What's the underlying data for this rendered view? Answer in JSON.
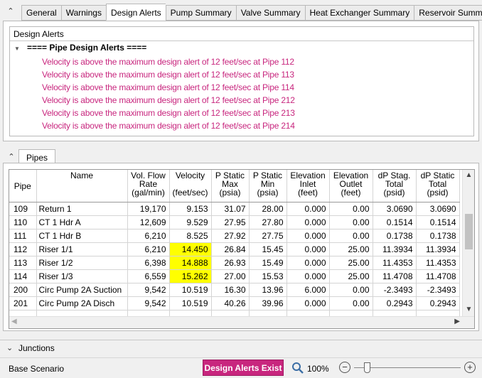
{
  "tabs": [
    "General",
    "Warnings",
    "Design Alerts",
    "Pump Summary",
    "Valve Summary",
    "Heat Exchanger Summary",
    "Reservoir Summary"
  ],
  "active_tab": "Design Alerts",
  "alerts_panel": {
    "title": "Design Alerts",
    "group_header": "==== Pipe Design Alerts ====",
    "items": [
      "Velocity is above the maximum design alert of 12 feet/sec at Pipe 112",
      "Velocity is above the maximum design alert of 12 feet/sec at Pipe 113",
      "Velocity is above the maximum design alert of 12 feet/sec at Pipe 114",
      "Velocity is above the maximum design alert of 12 feet/sec at Pipe 212",
      "Velocity is above the maximum design alert of 12 feet/sec at Pipe 213",
      "Velocity is above the maximum design alert of 12 feet/sec at Pipe 214"
    ],
    "alert_color": "#c8267e"
  },
  "pipes_panel": {
    "tab_label": "Pipes",
    "columns": [
      [
        "Pipe"
      ],
      [
        "Name"
      ],
      [
        "Vol. Flow",
        "Rate",
        "(gal/min)"
      ],
      [
        "Velocity",
        "",
        "(feet/sec)"
      ],
      [
        "P Static",
        "Max",
        "(psia)"
      ],
      [
        "P Static",
        "Min",
        "(psia)"
      ],
      [
        "Elevation",
        "Inlet",
        "(feet)"
      ],
      [
        "Elevation",
        "Outlet",
        "(feet)"
      ],
      [
        "dP Stag.",
        "Total",
        "(psid)"
      ],
      [
        "dP Static",
        "Total",
        "(psid)"
      ]
    ],
    "rows": [
      {
        "cells": [
          "109",
          "Return 1",
          "19,170",
          "9.153",
          "31.07",
          "28.00",
          "0.000",
          "0.00",
          "3.0690",
          "3.0690"
        ],
        "highlight": false
      },
      {
        "cells": [
          "110",
          "CT 1 Hdr A",
          "12,609",
          "9.529",
          "27.95",
          "27.80",
          "0.000",
          "0.00",
          "0.1514",
          "0.1514"
        ],
        "highlight": false
      },
      {
        "cells": [
          "111",
          "CT 1 Hdr B",
          "6,210",
          "8.525",
          "27.92",
          "27.75",
          "0.000",
          "0.00",
          "0.1738",
          "0.1738"
        ],
        "highlight": false
      },
      {
        "cells": [
          "112",
          "Riser 1/1",
          "6,210",
          "14.450",
          "26.84",
          "15.45",
          "0.000",
          "25.00",
          "11.3934",
          "11.3934"
        ],
        "highlight": true
      },
      {
        "cells": [
          "113",
          "Riser 1/2",
          "6,398",
          "14.888",
          "26.93",
          "15.49",
          "0.000",
          "25.00",
          "11.4353",
          "11.4353"
        ],
        "highlight": true
      },
      {
        "cells": [
          "114",
          "Riser 1/3",
          "6,559",
          "15.262",
          "27.00",
          "15.53",
          "0.000",
          "25.00",
          "11.4708",
          "11.4708"
        ],
        "highlight": true
      },
      {
        "cells": [
          "200",
          "Circ Pump 2A Suction",
          "9,542",
          "10.519",
          "16.30",
          "13.96",
          "6.000",
          "0.00",
          "-2.3493",
          "-2.3493"
        ],
        "highlight": false
      },
      {
        "cells": [
          "201",
          "Circ Pump 2A Disch",
          "9,542",
          "10.519",
          "40.26",
          "39.96",
          "0.000",
          "0.00",
          "0.2943",
          "0.2943"
        ],
        "highlight": false
      }
    ],
    "highlight_color": "#ffff00"
  },
  "junctions_label": "Junctions",
  "status": {
    "scenario": "Base Scenario",
    "alerts_badge": "Design Alerts Exist",
    "zoom": "100%"
  }
}
